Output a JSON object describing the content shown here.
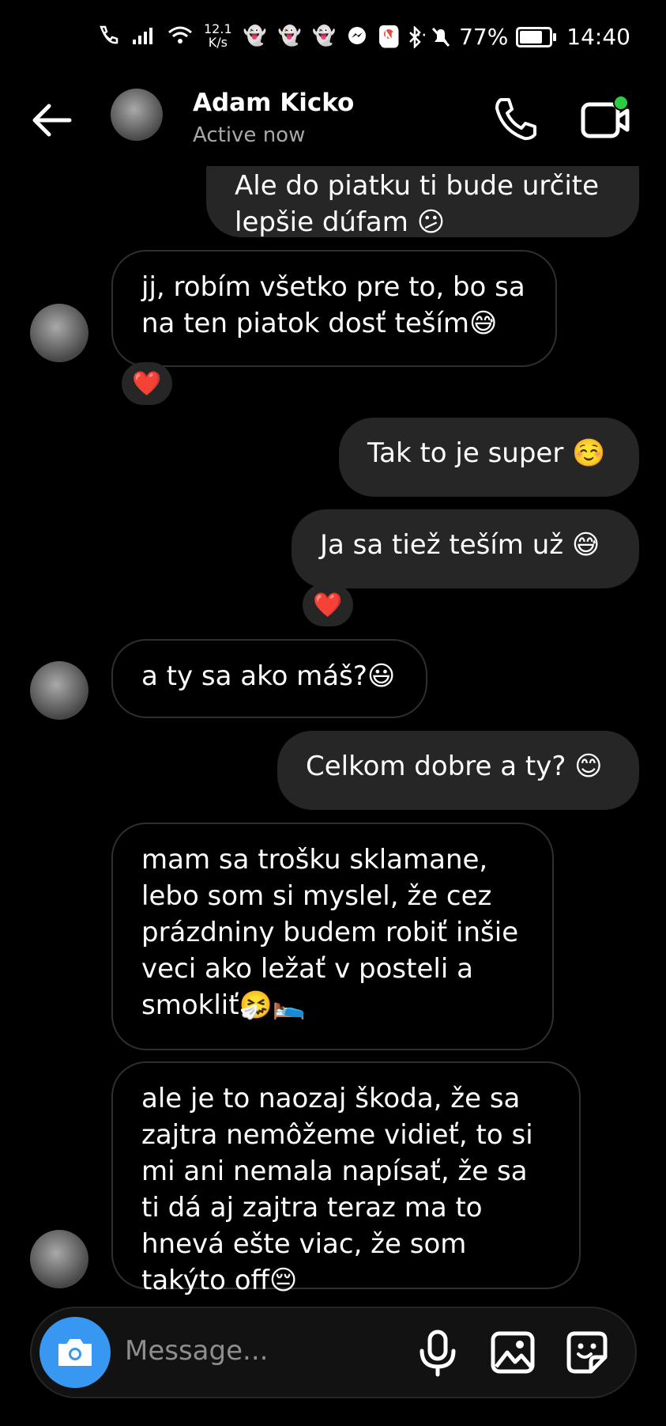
{
  "status_bar": {
    "speed": "12.1",
    "speed_unit": "K/s",
    "battery": "77%",
    "battery_level": 0.77,
    "time": "14:40",
    "extra": "···"
  },
  "header": {
    "contact_name": "Adam Kicko",
    "presence": "Active now"
  },
  "messages": [
    {
      "from": "me",
      "text": "Ale do piatku ti bude určite lepšie dúfam 😕"
    },
    {
      "from": "them",
      "text": "jj, robím všetko pre to, bo sa na ten piatok dosť teším😅",
      "reaction": "❤️"
    },
    {
      "from": "me",
      "text": "Tak to je super ☺️"
    },
    {
      "from": "me",
      "text": "Ja sa tiež teším už 😅",
      "reaction": "❤️"
    },
    {
      "from": "them",
      "text": "a ty sa ako máš?😃"
    },
    {
      "from": "me",
      "text": "Celkom dobre a ty? 😊"
    },
    {
      "from": "them",
      "text": "mam sa trošku sklamane, lebo som si myslel, že cez prázdniny budem robiť inšie veci ako ležať v posteli a smokliť🤧🛌"
    },
    {
      "from": "them",
      "text": "ale je to naozaj škoda, že sa zajtra nemôžeme vidieť, to si mi ani nemala napísať, že sa ti dá aj zajtra teraz ma to hnevá ešte viac, že som takýto off😔"
    }
  ],
  "composer": {
    "placeholder": "Message..."
  },
  "colors": {
    "accent": "#3897f0",
    "outgoing_bubble": "#262626",
    "online_dot": "#2ecc40",
    "reaction_heart": "#ff3040"
  }
}
